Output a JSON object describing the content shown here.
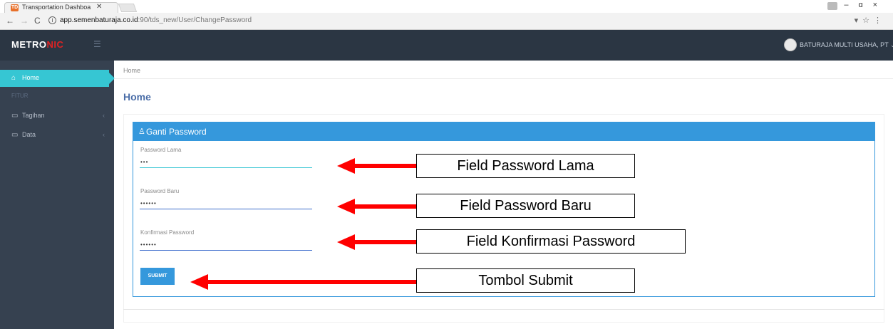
{
  "browser": {
    "tab_favicon_text": "TD",
    "tab_title": "Transportation Dashboa",
    "tab_close": "✕",
    "url_host": "app.semenbaturaja.co.id",
    "url_path": ":90/tds_new/User/ChangePassword"
  },
  "header": {
    "logo_main": "METRO",
    "logo_accent": "NIC",
    "user_name": "BATURAJA MULTI USAHA, PT ⌄"
  },
  "sidebar": {
    "home_label": "Home",
    "section_heading": "FITUR",
    "items": [
      {
        "label": "Tagihan",
        "icon": "bill-icon"
      },
      {
        "label": "Data",
        "icon": "monitor-icon"
      }
    ]
  },
  "breadcrumb": "Home",
  "page_title": "Home",
  "form": {
    "title": "Ganti Password",
    "fields": [
      {
        "label": "Password Lama",
        "value": "•••"
      },
      {
        "label": "Password Baru",
        "value": "••••••"
      },
      {
        "label": "Konfirmasi Password",
        "value": "••••••"
      }
    ],
    "submit_label": "SUBMIT"
  },
  "annotations": {
    "callouts": [
      "Field Password Lama",
      "Field Password Baru",
      "Field Konfirmasi Password",
      "Tombol Submit"
    ],
    "arrow_color": "#ff0000"
  },
  "colors": {
    "topbar": "#2b3643",
    "sidebar": "#364150",
    "active_nav": "#36c6d3",
    "portlet": "#3598dc",
    "title": "#4b6ea8"
  }
}
